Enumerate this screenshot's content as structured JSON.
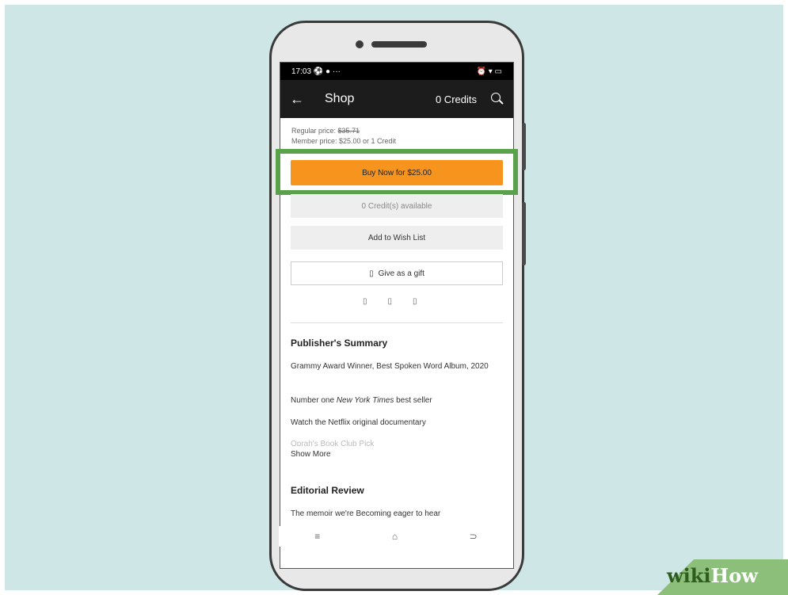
{
  "status_bar": {
    "time": "17:03",
    "left_icons": "⚽ ● ···",
    "right_icons": "⏰ ▾ ▭"
  },
  "app_bar": {
    "title": "Shop",
    "credits": "0 Credits"
  },
  "pricing": {
    "regular_label": "Regular price:",
    "regular_price": "$35.71",
    "member_label": "Member price: $25.00 or 1 Credit"
  },
  "buttons": {
    "buy_now": "Buy Now for $25.00",
    "credits_available": "0 Credit(s) available",
    "wish_list": "Add to Wish List",
    "gift": "Give as a gift",
    "gift_icon": "▯"
  },
  "share_icons": [
    "▯",
    "▯",
    "▯"
  ],
  "publisher_summary": {
    "heading": "Publisher's Summary",
    "line1": "Grammy Award Winner, Best Spoken Word Album, 2020",
    "line2_pre": "Number one ",
    "line2_em": "New York Times",
    "line2_post": " best seller",
    "line3": "Watch the Netflix original documentary",
    "line4": "Oprah's Book Club Pick",
    "show_more": "Show More"
  },
  "editorial": {
    "heading": "Editorial Review",
    "line1": "The memoir we're Becoming eager to hear"
  },
  "nav": {
    "menu": "≡",
    "home": "⌂",
    "back": "⊃"
  },
  "brand": {
    "wiki": "wiki",
    "how": "How"
  },
  "colors": {
    "accent": "#f7941d",
    "highlight": "#5aa14b",
    "background": "#cfe6e7"
  }
}
